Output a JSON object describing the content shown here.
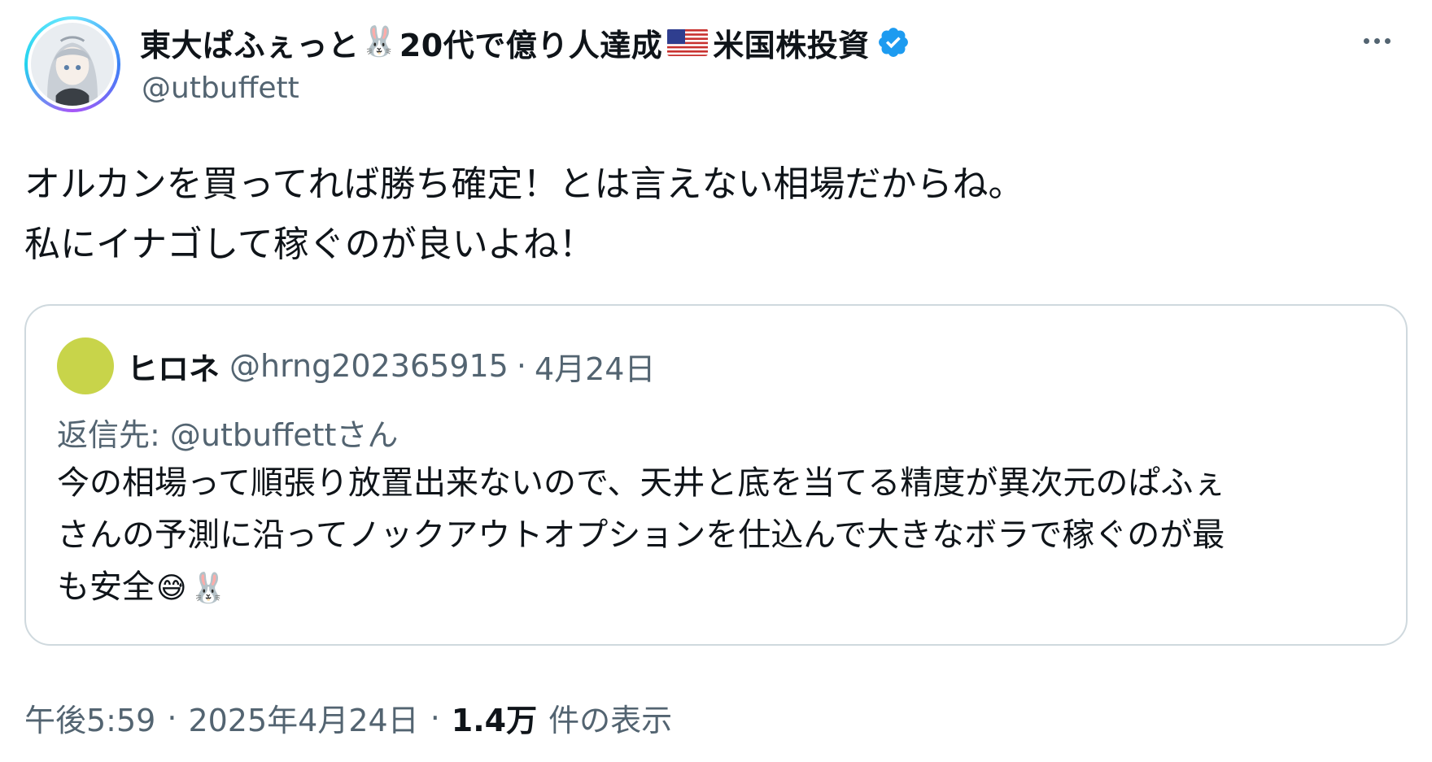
{
  "author": {
    "name_part1": "東大ぱふぇっと",
    "name_emoji1": "🐰",
    "name_part2": "20代で億り人達成",
    "name_part3": "米国株投資",
    "handle": "@utbuffett",
    "verified": true,
    "verified_color": "#1d9bf0"
  },
  "tweet": {
    "line1": "オルカンを買ってれば勝ち確定！とは言えない相場だからね。",
    "line2": "私にイナゴして稼ぐのが良いよね！"
  },
  "quote": {
    "avatar_color": "#c8d44a",
    "name": "ヒロネ",
    "handle": "@hrng202365915",
    "separator": "·",
    "date": "4月24日",
    "reply_to": "返信先: @utbuffettさん",
    "line1": "今の相場って順張り放置出来ないので、天井と底を当てる精度が異次元のぱふぇ",
    "line2": "さんの予測に沿ってノックアウトオプションを仕込んで大きなボラで稼ぐのが最",
    "line3": "も安全",
    "emoji1": "😅",
    "emoji2": "🐰"
  },
  "footer": {
    "time": "午後5:59",
    "separator": "·",
    "date": "2025年4月24日",
    "views_count": "1.4万",
    "views_label": "件の表示"
  },
  "colors": {
    "text": "#0f1419",
    "secondary": "#536471",
    "border": "#cfd9de"
  }
}
